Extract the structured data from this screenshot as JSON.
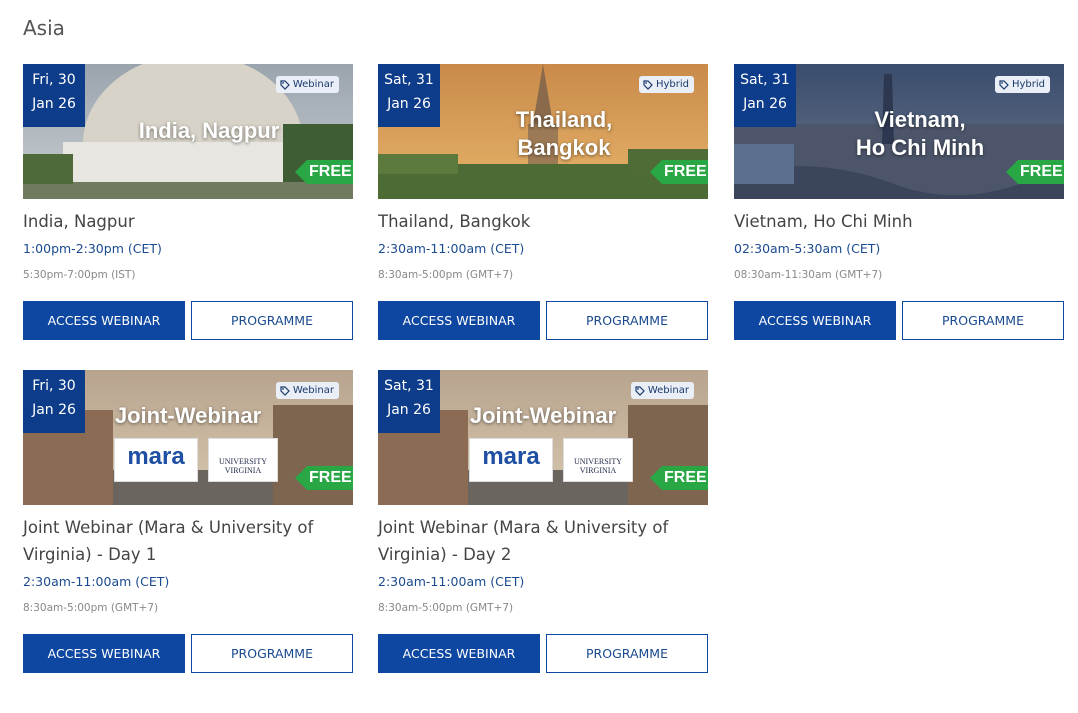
{
  "section": {
    "title": "Asia"
  },
  "colors": {
    "accent": "#0d47a1",
    "badge": "#0d3c8a",
    "free": "#29a745"
  },
  "cards": [
    {
      "day": "Fri, 30",
      "month": "Jan 26",
      "type": "Webinar",
      "image_title_1": "India, Nagpur",
      "image_title_2": "",
      "free": "FREE",
      "title": "India,  Nagpur",
      "time_cet": "1:00pm-2:30pm (CET)",
      "time_local": "5:30pm-7:00pm (IST)",
      "btn_access": "ACCESS WEBINAR",
      "btn_programme": "PROGRAMME"
    },
    {
      "day": "Sat, 31",
      "month": "Jan 26",
      "type": "Hybrid",
      "image_title_1": "Thailand,",
      "image_title_2": "Bangkok",
      "free": "FREE",
      "title": "Thailand,  Bangkok",
      "time_cet": "2:30am-11:00am (CET)",
      "time_local": "8:30am-5:00pm (GMT+7)",
      "btn_access": "ACCESS WEBINAR",
      "btn_programme": "PROGRAMME"
    },
    {
      "day": "Sat, 31",
      "month": "Jan 26",
      "type": "Hybrid",
      "image_title_1": "Vietnam,",
      "image_title_2": "Ho Chi Minh",
      "free": "FREE",
      "title": "Vietnam,  Ho Chi  Minh",
      "time_cet": "02:30am-5:30am (CET)",
      "time_local": "08:30am-11:30am (GMT+7)",
      "btn_access": "ACCESS WEBINAR",
      "btn_programme": "PROGRAMME"
    },
    {
      "day": "Fri, 30",
      "month": "Jan 26",
      "type": "Webinar",
      "image_title_1": "Joint-Webinar",
      "image_title_2": "",
      "free": "FREE",
      "logo_mara": "mara",
      "logo_uva_1": "UNIVERSITY",
      "logo_uva_2": "VIRGINIA",
      "title": "Joint Webinar (Mara & University of Virginia) -  Day 1",
      "time_cet": "2:30am-11:00am (CET)",
      "time_local": "8:30am-5:00pm (GMT+7)",
      "btn_access": "ACCESS WEBINAR",
      "btn_programme": "PROGRAMME"
    },
    {
      "day": "Sat, 31",
      "month": "Jan 26",
      "type": "Webinar",
      "image_title_1": "Joint-Webinar",
      "image_title_2": "",
      "free": "FREE",
      "logo_mara": "mara",
      "logo_uva_1": "UNIVERSITY",
      "logo_uva_2": "VIRGINIA",
      "title": "Joint Webinar (Mara & University of Virginia) -  Day 2",
      "time_cet": "2:30am-11:00am (CET)",
      "time_local": "8:30am-5:00pm (GMT+7)",
      "btn_access": "ACCESS WEBINAR",
      "btn_programme": "PROGRAMME"
    }
  ]
}
